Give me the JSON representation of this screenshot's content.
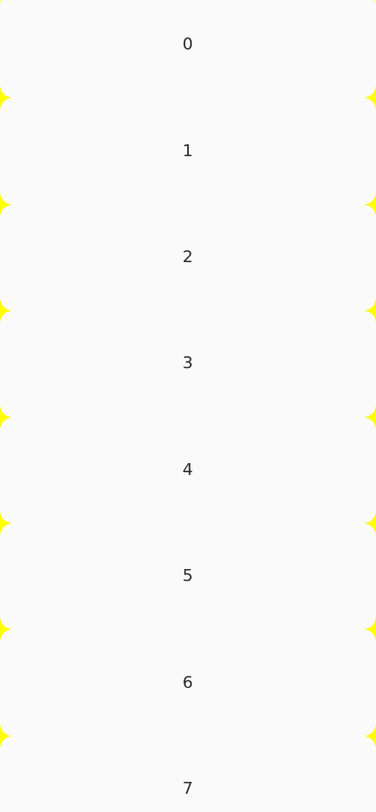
{
  "list": {
    "items": [
      {
        "label": "0"
      },
      {
        "label": "1"
      },
      {
        "label": "2"
      },
      {
        "label": "3"
      },
      {
        "label": "4"
      },
      {
        "label": "5"
      },
      {
        "label": "6"
      },
      {
        "label": "7"
      }
    ]
  },
  "colors": {
    "background": "#fafafa",
    "divider": "#ffff00",
    "text": "#2b2b2b"
  }
}
